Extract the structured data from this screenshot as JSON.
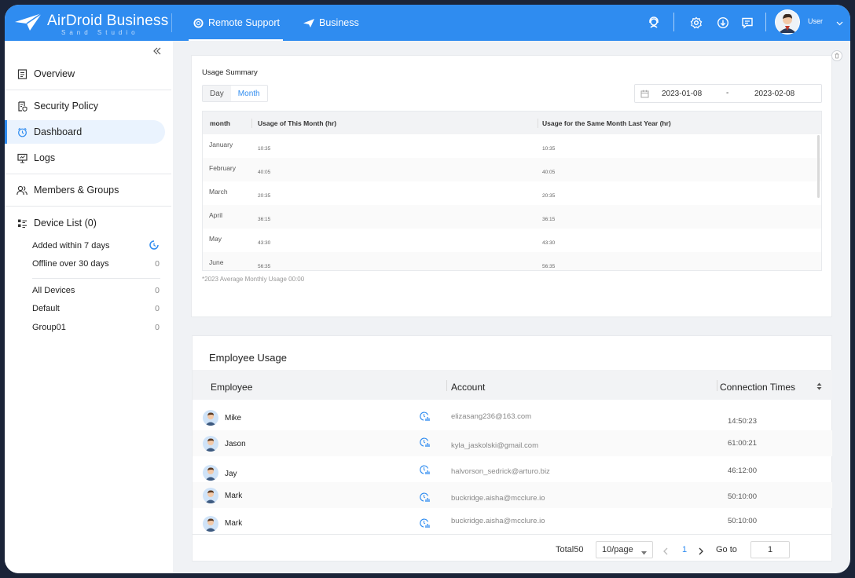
{
  "colors": {
    "primary": "#2f8cf0",
    "sidebar_active_bg": "#eaf3fe",
    "border": "#e8eaed"
  },
  "header": {
    "brand": "AirDroid Business",
    "brand_sub": "Sand Studio",
    "tabs": [
      {
        "label": "Remote Support",
        "icon": "lifebuoy-icon",
        "active": true
      },
      {
        "label": "Business",
        "icon": "paper-plane-icon",
        "active": false
      }
    ],
    "icons": [
      "headset-icon",
      "gear-icon",
      "download-icon",
      "message-icon"
    ],
    "user": "User"
  },
  "sidebar": {
    "items": [
      {
        "label": "Overview",
        "icon": "document-icon"
      },
      {
        "label": "Security Policy",
        "icon": "shield-doc-icon"
      },
      {
        "label": "Dashboard",
        "icon": "alarm-clock-icon",
        "active": true
      },
      {
        "label": "Logs",
        "icon": "monitor-icon"
      },
      {
        "label": "Members & Groups",
        "icon": "users-icon"
      },
      {
        "label": "Device List (0)",
        "icon": "list-icon"
      }
    ],
    "device_filters": [
      {
        "label": "Added within 7 days",
        "count": ""
      },
      {
        "label": "Offline over 30 days",
        "count": "0"
      }
    ],
    "groups": [
      {
        "label": "All Devices",
        "count": "0"
      },
      {
        "label": "Default",
        "count": "0"
      },
      {
        "label": "Group01",
        "count": "0"
      }
    ]
  },
  "usage_summary": {
    "title": "Usage Summary",
    "toggle": {
      "day": "Day",
      "month": "Month",
      "selected": "Month"
    },
    "date_from": "2023-01-08",
    "date_sep": "-",
    "date_to": "2023-02-08",
    "columns": [
      "month",
      "Usage of This Month (hr)",
      "Usage for the Same Month Last Year (hr)"
    ],
    "rows": [
      {
        "month": "January",
        "this": "10:35",
        "last": "10:35"
      },
      {
        "month": "February",
        "this": "40:05",
        "last": "40:05"
      },
      {
        "month": "March",
        "this": "20:35",
        "last": "20:35"
      },
      {
        "month": "April",
        "this": "36:15",
        "last": "36:15"
      },
      {
        "month": "May",
        "this": "43:30",
        "last": "43:30"
      },
      {
        "month": "June",
        "this": "56:35",
        "last": "56:35"
      }
    ],
    "note": "*2023 Average Monthly Usage 00:00"
  },
  "employee_usage": {
    "title": "Employee Usage",
    "columns": [
      "Employee",
      "Account",
      "Connection Times"
    ],
    "rows": [
      {
        "name": "Mike",
        "account": "elizasang236@163.com",
        "time": "14:50:23"
      },
      {
        "name": "Jason",
        "account": "kyla_jaskolski@gmail.com",
        "time": "61:00:21"
      },
      {
        "name": "Jay",
        "account": "halvorson_sedrick@arturo.biz",
        "time": "46:12:00"
      },
      {
        "name": "Mark",
        "account": "buckridge.aisha@mcclure.io",
        "time": "50:10:00"
      },
      {
        "name": "Mark",
        "account": "buckridge.aisha@mcclure.io",
        "time": "50:10:00"
      }
    ],
    "pagination": {
      "total": "Total50",
      "page_size": "10/page",
      "current": "1",
      "goto_label": "Go to",
      "goto_value": "1"
    }
  }
}
